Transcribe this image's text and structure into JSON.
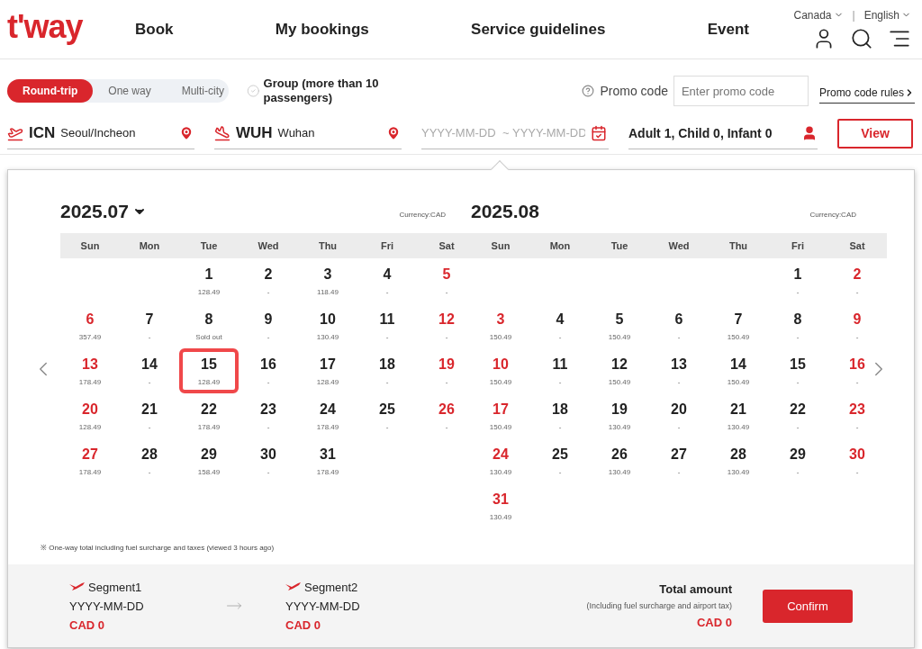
{
  "header": {
    "logo": "t'way",
    "nav": [
      "Book",
      "My bookings",
      "Service guidelines",
      "Event"
    ],
    "region": "Canada",
    "separator": "|",
    "language": "English"
  },
  "search": {
    "trip_types": [
      {
        "label": "Round-trip",
        "selected": true
      },
      {
        "label": "One way",
        "selected": false
      },
      {
        "label": "Multi-city",
        "selected": false
      }
    ],
    "group": {
      "label": "Group (more than 10 passengers)",
      "checked": false
    },
    "promo": {
      "label": "Promo code",
      "placeholder": "Enter promo code",
      "rules_link": "Promo code rules"
    },
    "origin": {
      "code": "ICN",
      "city": "Seoul/Incheon"
    },
    "destination": {
      "code": "WUH",
      "city": "Wuhan"
    },
    "date_from": {
      "placeholder": "YYYY-MM-DD"
    },
    "date_to": {
      "placeholder": "~ YYYY-MM-DD"
    },
    "passengers": "Adult 1, Child 0, Infant 0",
    "view_button": "View"
  },
  "calendar": {
    "months": [
      {
        "title": "2025.07",
        "dropdown": true,
        "currency": "Currency:CAD",
        "weekdays": [
          "Sun",
          "Mon",
          "Tue",
          "Wed",
          "Thu",
          "Fri",
          "Sat"
        ],
        "weeks": [
          [
            {
              "day": "1",
              "price": "128.49",
              "selected": false
            },
            {
              "day": "2",
              "price": "-",
              "selected": false
            },
            {
              "day": "3",
              "price": "118.49",
              "selected": false
            },
            {
              "day": "4",
              "price": "-",
              "selected": false
            },
            {
              "day": "5",
              "price": "-",
              "selected": false
            }
          ],
          [
            {
              "day": "6",
              "price": "357.49",
              "selected": false
            },
            {
              "day": "7",
              "price": "-",
              "selected": false
            },
            {
              "day": "8",
              "price": "Sold out",
              "selected": false
            },
            {
              "day": "9",
              "price": "-",
              "selected": false
            },
            {
              "day": "10",
              "price": "130.49",
              "selected": false
            },
            {
              "day": "11",
              "price": "-",
              "selected": false
            },
            {
              "day": "12",
              "price": "-",
              "selected": false
            }
          ],
          [
            {
              "day": "13",
              "price": "178.49",
              "selected": false
            },
            {
              "day": "14",
              "price": "-",
              "selected": false
            },
            {
              "day": "15",
              "price": "128.49",
              "selected": true
            },
            {
              "day": "16",
              "price": "-",
              "selected": false
            },
            {
              "day": "17",
              "price": "128.49",
              "selected": false
            },
            {
              "day": "18",
              "price": "-",
              "selected": false
            },
            {
              "day": "19",
              "price": "-",
              "selected": false
            }
          ],
          [
            {
              "day": "20",
              "price": "128.49",
              "selected": false
            },
            {
              "day": "21",
              "price": "-",
              "selected": false
            },
            {
              "day": "22",
              "price": "178.49",
              "selected": false
            },
            {
              "day": "23",
              "price": "-",
              "selected": false
            },
            {
              "day": "24",
              "price": "178.49",
              "selected": false
            },
            {
              "day": "25",
              "price": "-",
              "selected": false
            },
            {
              "day": "26",
              "price": "-",
              "selected": false
            }
          ],
          [
            {
              "day": "27",
              "price": "178.49",
              "selected": false
            },
            {
              "day": "28",
              "price": "-",
              "selected": false
            },
            {
              "day": "29",
              "price": "158.49",
              "selected": false
            },
            {
              "day": "30",
              "price": "-",
              "selected": false
            },
            {
              "day": "31",
              "price": "178.49",
              "selected": false
            }
          ]
        ]
      },
      {
        "title": "2025.08",
        "dropdown": false,
        "currency": "Currency:CAD",
        "weekdays": [
          "Sun",
          "Mon",
          "Tue",
          "Wed",
          "Thu",
          "Fri",
          "Sat"
        ],
        "weeks": [
          [
            {
              "day": "1",
              "price": "-",
              "selected": false
            },
            {
              "day": "2",
              "price": "-",
              "selected": false
            }
          ],
          [
            {
              "day": "3",
              "price": "150.49",
              "selected": false
            },
            {
              "day": "4",
              "price": "-",
              "selected": false
            },
            {
              "day": "5",
              "price": "150.49",
              "selected": false
            },
            {
              "day": "6",
              "price": "-",
              "selected": false
            },
            {
              "day": "7",
              "price": "150.49",
              "selected": false
            },
            {
              "day": "8",
              "price": "-",
              "selected": false
            },
            {
              "day": "9",
              "price": "-",
              "selected": false
            }
          ],
          [
            {
              "day": "10",
              "price": "150.49",
              "selected": false
            },
            {
              "day": "11",
              "price": "-",
              "selected": false
            },
            {
              "day": "12",
              "price": "150.49",
              "selected": false
            },
            {
              "day": "13",
              "price": "-",
              "selected": false
            },
            {
              "day": "14",
              "price": "150.49",
              "selected": false
            },
            {
              "day": "15",
              "price": "-",
              "selected": false
            },
            {
              "day": "16",
              "price": "-",
              "selected": false
            }
          ],
          [
            {
              "day": "17",
              "price": "150.49",
              "selected": false
            },
            {
              "day": "18",
              "price": "-",
              "selected": false
            },
            {
              "day": "19",
              "price": "130.49",
              "selected": false
            },
            {
              "day": "20",
              "price": "-",
              "selected": false
            },
            {
              "day": "21",
              "price": "130.49",
              "selected": false
            },
            {
              "day": "22",
              "price": "-",
              "selected": false
            },
            {
              "day": "23",
              "price": "-",
              "selected": false
            }
          ],
          [
            {
              "day": "24",
              "price": "130.49",
              "selected": false
            },
            {
              "day": "25",
              "price": "-",
              "selected": false
            },
            {
              "day": "26",
              "price": "130.49",
              "selected": false
            },
            {
              "day": "27",
              "price": "-",
              "selected": false
            },
            {
              "day": "28",
              "price": "130.49",
              "selected": false
            },
            {
              "day": "29",
              "price": "-",
              "selected": false
            },
            {
              "day": "30",
              "price": "-",
              "selected": false
            }
          ],
          [
            {
              "day": "31",
              "price": "130.49",
              "selected": false
            }
          ]
        ]
      }
    ],
    "note": "※ One-way total including fuel surcharge and taxes (viewed 3 hours ago)"
  },
  "summary": {
    "segments": [
      {
        "label": "Segment1",
        "date": "YYYY-MM-DD",
        "price": "CAD 0"
      },
      {
        "label": "Segment2",
        "date": "YYYY-MM-DD",
        "price": "CAD 0"
      }
    ],
    "total_label": "Total amount",
    "total_note": "(Including fuel surcharge and airport tax)",
    "total": "CAD 0",
    "confirm_button": "Confirm"
  }
}
